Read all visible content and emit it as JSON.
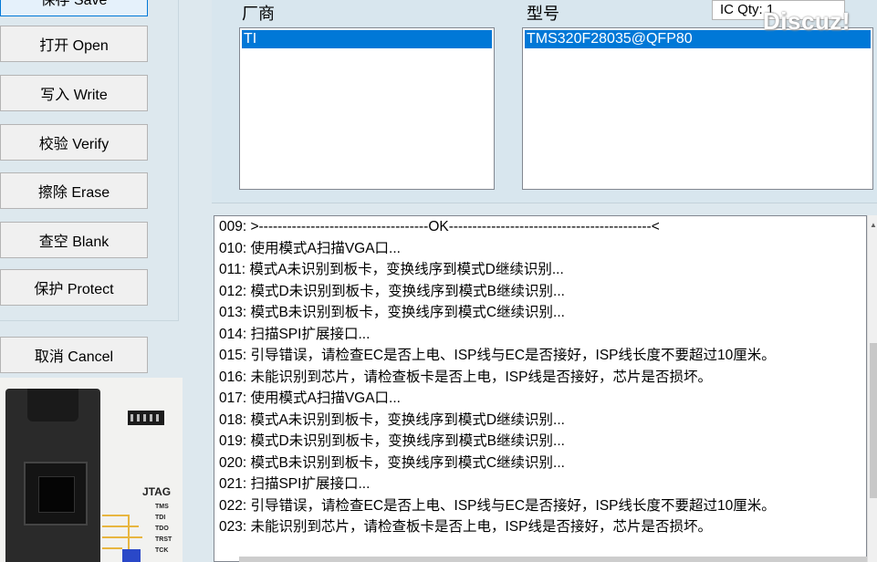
{
  "left_buttons": {
    "save": "保存 Save",
    "open": "打开 Open",
    "write": "写入 Write",
    "verify": "校验 Verify",
    "erase": "擦除 Erase",
    "blank": "查空 Blank",
    "protect": "保护 Protect",
    "cancel": "取消 Cancel"
  },
  "photo": {
    "jtag_label": "JTAG",
    "jtag_pins": [
      "TMS",
      "TDI",
      "TDO",
      "TRST",
      "TCK"
    ]
  },
  "vendor": {
    "label": "厂商",
    "selected": "TI"
  },
  "model": {
    "label": "型号",
    "selected": "TMS320F28035@QFP80"
  },
  "ic_qty": "IC Qty: 1",
  "watermark": "Discuz!",
  "log": [
    "009:  >------------------------------------OK-------------------------------------------<",
    "010:  使用模式A扫描VGA口...",
    "011:  模式A未识别到板卡，变换线序到模式D继续识别...",
    "012:  模式D未识别到板卡，变换线序到模式B继续识别...",
    "013:  模式B未识别到板卡，变换线序到模式C继续识别...",
    "014:  扫描SPI扩展接口...",
    "015:  引导错误，请检查EC是否上电、ISP线与EC是否接好，ISP线长度不要超过10厘米。",
    "016:  未能识别到芯片，请检查板卡是否上电，ISP线是否接好，芯片是否损坏。",
    "017:  使用模式A扫描VGA口...",
    "018:  模式A未识别到板卡，变换线序到模式D继续识别...",
    "019:  模式D未识别到板卡，变换线序到模式B继续识别...",
    "020:  模式B未识别到板卡，变换线序到模式C继续识别...",
    "021:  扫描SPI扩展接口...",
    "022:  引导错误，请检查EC是否上电、ISP线与EC是否接好，ISP线长度不要超过10厘米。",
    "023:  未能识别到芯片，请检查板卡是否上电，ISP线是否接好，芯片是否损坏。"
  ],
  "colors": {
    "selection": "#0078d7",
    "panel_bg": "#dde8ee"
  }
}
